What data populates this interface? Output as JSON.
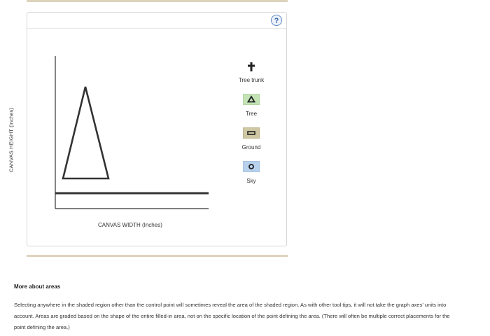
{
  "help": {
    "label": "?"
  },
  "graph": {
    "y_axis_label": "CANVAS HEIGHT (Inches)",
    "x_axis_label": "CANVAS WIDTH (Inches)"
  },
  "toolbox": [
    {
      "label": "Tree trunk",
      "icon": "cross-icon"
    },
    {
      "label": "Tree",
      "icon": "triangle-icon",
      "color": "#c3e3b5"
    },
    {
      "label": "Ground",
      "icon": "rectangle-icon",
      "color": "#cfc7a3"
    },
    {
      "label": "Sky",
      "icon": "circle-icon",
      "color": "#b8d1ec"
    }
  ],
  "info": {
    "title": "More about areas",
    "body": "Selecting anywhere in the shaded region other than the control point will sometimes reveal the area of the shaded region. As with other tool tips, it will not take the graph axes' units into account. Areas are graded based on the shape of the entire filled-in area, not on the specific location of the point defining the area. (There will often be multiple correct placements for the point defining the area.)"
  }
}
